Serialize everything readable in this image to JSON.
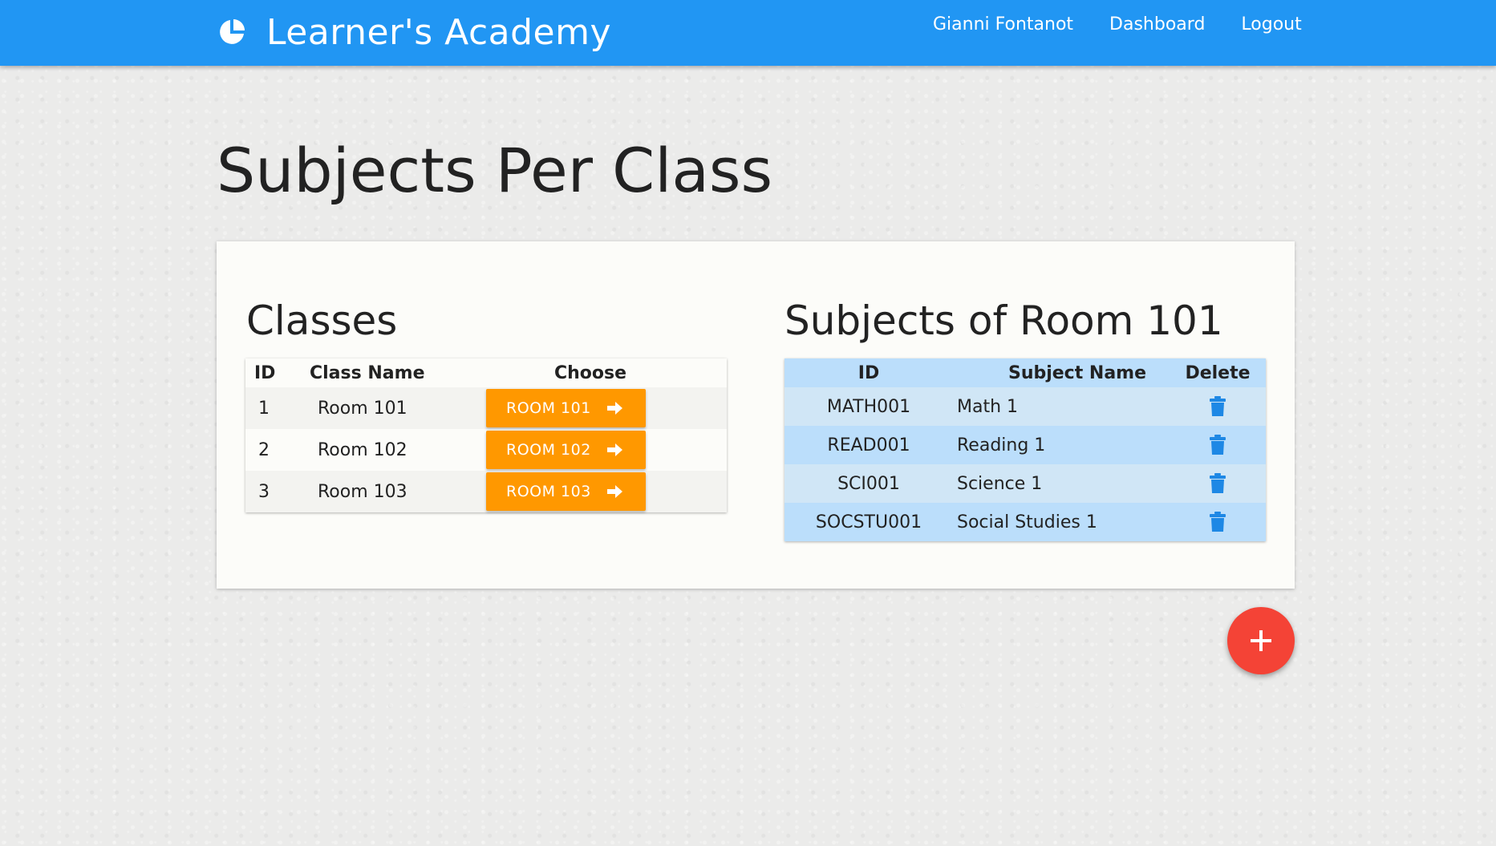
{
  "app": {
    "title": "Learner's Academy",
    "brand_icon": "pie-chart-icon"
  },
  "nav": {
    "user": "Gianni Fontanot",
    "dashboard": "Dashboard",
    "logout": "Logout"
  },
  "page": {
    "title": "Subjects Per Class"
  },
  "classes": {
    "title": "Classes",
    "headers": {
      "id": "ID",
      "name": "Class Name",
      "choose": "Choose"
    },
    "rows": [
      {
        "id": "1",
        "name": "Room 101",
        "button": "ROOM 101"
      },
      {
        "id": "2",
        "name": "Room 102",
        "button": "ROOM 102"
      },
      {
        "id": "3",
        "name": "Room 103",
        "button": "ROOM 103"
      }
    ]
  },
  "subjects": {
    "title": "Subjects of Room 101",
    "headers": {
      "id": "ID",
      "name": "Subject Name",
      "delete": "Delete"
    },
    "rows": [
      {
        "id": "MATH001",
        "name": "Math 1"
      },
      {
        "id": "READ001",
        "name": "Reading 1"
      },
      {
        "id": "SCI001",
        "name": "Science 1"
      },
      {
        "id": "SOCSTU001",
        "name": "Social Studies 1"
      }
    ]
  },
  "colors": {
    "navbar": "#2196f3",
    "choose_button": "#ff9800",
    "add_button": "#f44336",
    "subjects_table": "#bbdefb",
    "trash_icon": "#1e88e5"
  },
  "icons": {
    "choose": "arrow-right-icon",
    "delete": "trash-icon",
    "add": "plus-icon"
  }
}
